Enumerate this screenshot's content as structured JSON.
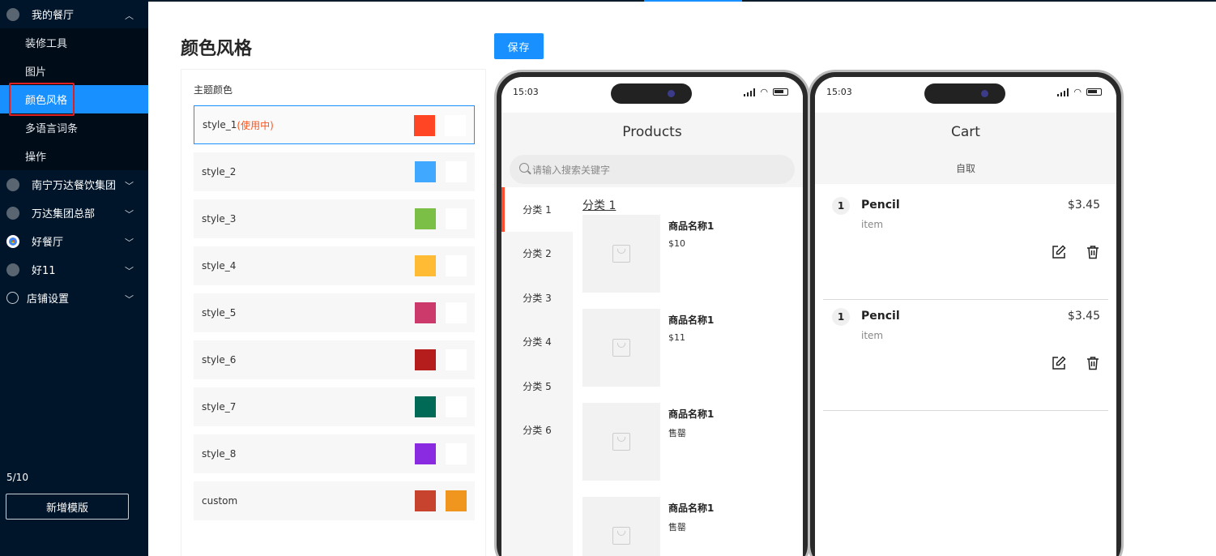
{
  "sidebar": {
    "groups": [
      {
        "label": "我的餐厅",
        "expanded": true,
        "icon": "chrome-icon"
      },
      {
        "label": "南宁万达餐饮集团",
        "icon": "chrome-icon"
      },
      {
        "label": "万达集团总部",
        "icon": "chrome-icon"
      },
      {
        "label": "好餐厅",
        "icon": "chrome-color-icon"
      },
      {
        "label": "好11",
        "icon": "chrome-icon"
      },
      {
        "label": "店铺设置",
        "icon": "list-circle-icon"
      }
    ],
    "sub_items": [
      {
        "label": "装修工具"
      },
      {
        "label": "图片"
      },
      {
        "label": "颜色风格",
        "active": true
      },
      {
        "label": "多语言词条"
      },
      {
        "label": "操作"
      }
    ],
    "counter": "5/10",
    "new_template": "新增模版"
  },
  "page": {
    "title": "颜色风格",
    "save": "保存",
    "theme_label": "主题颜色"
  },
  "styles": [
    {
      "name": "style_1",
      "badge": "(使用中)",
      "primary": "#ff4524",
      "secondary": "#ffffff",
      "current": true
    },
    {
      "name": "style_2",
      "primary": "#40a9ff",
      "secondary": "#ffffff"
    },
    {
      "name": "style_3",
      "primary": "#7cbf47",
      "secondary": "#ffffff"
    },
    {
      "name": "style_4",
      "primary": "#ffbb33",
      "secondary": "#ffffff"
    },
    {
      "name": "style_5",
      "primary": "#cc3a6b",
      "secondary": "#ffffff"
    },
    {
      "name": "style_6",
      "primary": "#b51d1d",
      "secondary": "#ffffff"
    },
    {
      "name": "style_7",
      "primary": "#006a56",
      "secondary": "#ffffff"
    },
    {
      "name": "style_8",
      "primary": "#8a2be2",
      "secondary": "#ffffff"
    },
    {
      "name": "custom",
      "primary": "#c8432d",
      "secondary": "#f0961f"
    }
  ],
  "phone_products": {
    "time": "15:03",
    "title": "Products",
    "search_placeholder": "请输入搜索关键字",
    "categories": [
      "分类 1",
      "分类 2",
      "分类 3",
      "分类 4",
      "分类 5",
      "分类 6"
    ],
    "heading": "分类 1",
    "products": [
      {
        "name": "商品名称1",
        "price": "$10"
      },
      {
        "name": "商品名称1",
        "price": "$11"
      },
      {
        "name": "商品名称1",
        "price": "售罄"
      },
      {
        "name": "商品名称1",
        "price": "售罄"
      }
    ]
  },
  "phone_cart": {
    "time": "15:03",
    "title": "Cart",
    "pickup": "自取",
    "items": [
      {
        "qty": "1",
        "name": "Pencil",
        "sub": "item",
        "price": "$3.45"
      },
      {
        "qty": "1",
        "name": "Pencil",
        "sub": "item",
        "price": "$3.45"
      }
    ]
  }
}
